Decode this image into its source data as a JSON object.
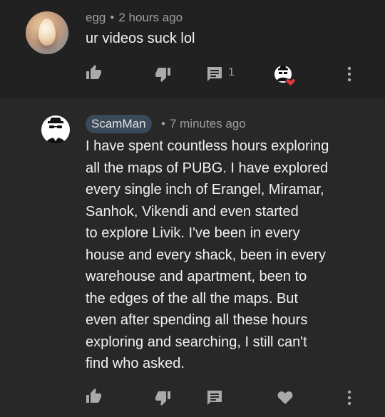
{
  "top_comment": {
    "author": "egg",
    "separator": "•",
    "timestamp": "2 hours ago",
    "text": "ur videos suck lol",
    "reply_count": "1",
    "icons": {
      "like": "thumbs-up-icon",
      "dislike": "thumbs-down-icon",
      "reply": "reply-comment-icon",
      "creator_heart": "creator-heart-icon",
      "more": "more-vertical-icon"
    }
  },
  "reply": {
    "author": "ScamMan",
    "separator": "•",
    "timestamp": "7 minutes ago",
    "lines": [
      "I have spent countless hours exploring",
      "all the maps of PUBG. I have explored",
      "every single inch of Erangel, Miramar,",
      "Sanhok, Vikendi and even started",
      "to explore Livik. I've been in every",
      "house and every shack, been in every",
      "warehouse and apartment, been to",
      "the edges of the all the maps. But",
      "even after spending all these hours",
      "exploring and searching, I still can't",
      "find who asked."
    ],
    "icons": {
      "like": "thumbs-up-icon",
      "dislike": "thumbs-down-icon",
      "reply": "reply-comment-icon",
      "heart": "heart-icon",
      "more": "more-vertical-icon"
    }
  },
  "colors": {
    "background_top": "#212121",
    "background_reply": "#282828",
    "text_primary": "#f1f1f1",
    "text_secondary": "#9e9e9e",
    "author_chip": "#3b4a5a",
    "heart": "#e53935"
  }
}
